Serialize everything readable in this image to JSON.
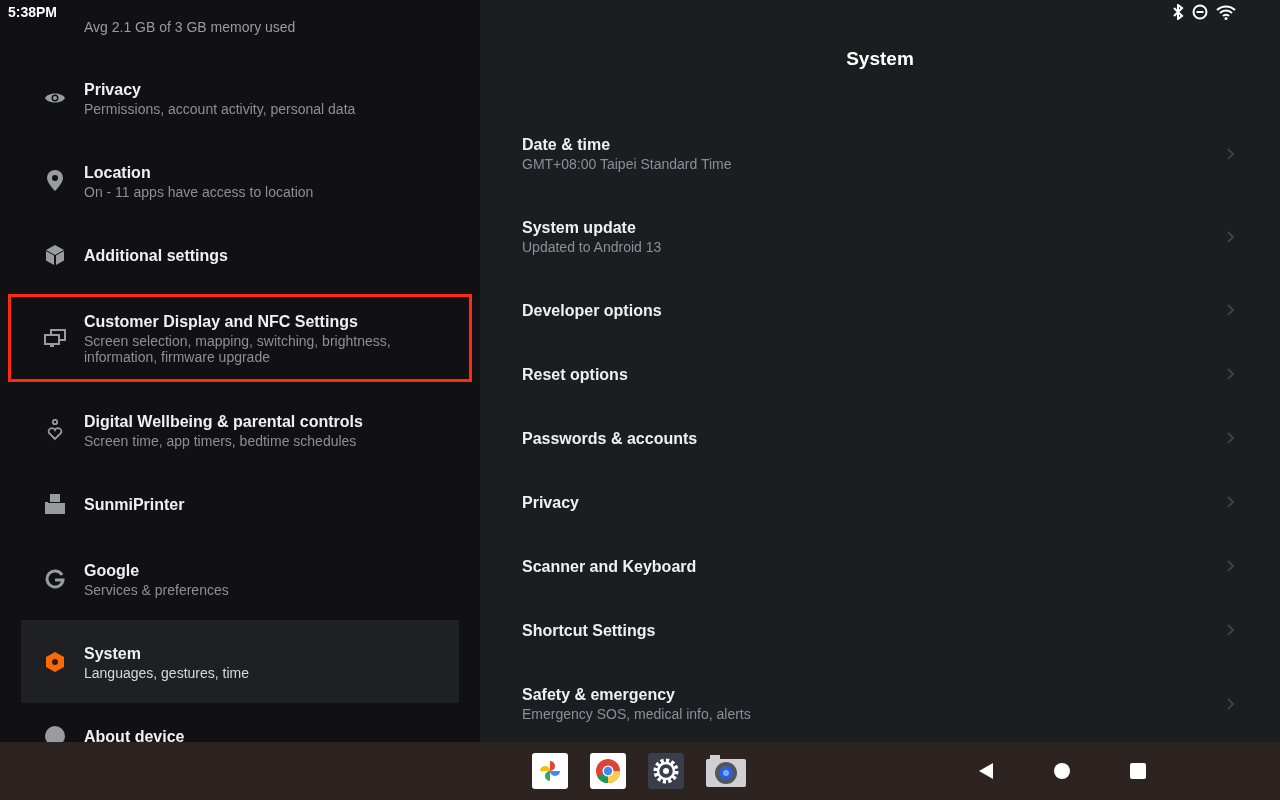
{
  "status_bar": {
    "time": "5:38PM"
  },
  "sidebar": {
    "top_text": "Avg 2.1 GB of 3 GB memory used",
    "items": [
      {
        "kind": "eye",
        "title": "Privacy",
        "subtitle": "Permissions, account activity, personal data",
        "selected": false,
        "outlined": false
      },
      {
        "kind": "pin",
        "title": "Location",
        "subtitle": "On - 11 apps have access to location",
        "selected": false,
        "outlined": false
      },
      {
        "kind": "cube",
        "title": "Additional settings",
        "selected": false,
        "outlined": false
      },
      {
        "kind": "screens",
        "title": "Customer Display and NFC Settings",
        "subtitle": "Screen selection, mapping, switching, brightness, information, firmware upgrade",
        "selected": false,
        "outlined": true
      },
      {
        "kind": "wellbeing",
        "title": "Digital Wellbeing & parental controls",
        "subtitle": "Screen time, app timers, bedtime schedules",
        "selected": false,
        "outlined": false
      },
      {
        "kind": "printer",
        "title": "SunmiPrinter",
        "selected": false,
        "outlined": false
      },
      {
        "kind": "g",
        "title": "Google",
        "subtitle": "Services & preferences",
        "selected": false,
        "outlined": false
      },
      {
        "kind": "hex",
        "title": "System",
        "subtitle": "Languages, gestures, time",
        "selected": true,
        "outlined": false
      },
      {
        "kind": "info",
        "title": "About device",
        "selected": false,
        "outlined": false
      }
    ]
  },
  "panel": {
    "title": "System",
    "items": [
      {
        "title": "Date & time",
        "subtitle": "GMT+08:00 Taipei Standard Time"
      },
      {
        "title": "System update",
        "subtitle": "Updated to Android 13"
      },
      {
        "title": "Developer options"
      },
      {
        "title": "Reset options"
      },
      {
        "title": "Passwords & accounts"
      },
      {
        "title": "Privacy"
      },
      {
        "title": "Scanner and Keyboard"
      },
      {
        "title": "Shortcut Settings"
      },
      {
        "title": "Safety & emergency",
        "subtitle": "Emergency SOS, medical info, alerts"
      }
    ]
  },
  "taskbar": {
    "apps": [
      {
        "kind": "photos"
      },
      {
        "kind": "chrome"
      },
      {
        "kind": "settings"
      },
      {
        "kind": "camera"
      }
    ]
  }
}
